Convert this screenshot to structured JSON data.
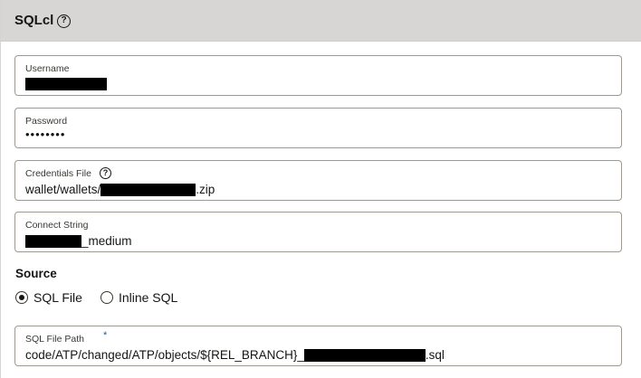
{
  "header": {
    "title": "SQLcl",
    "help_glyph": "?"
  },
  "fields": {
    "username": {
      "label": "Username",
      "value": ""
    },
    "password": {
      "label": "Password",
      "value": "••••••••"
    },
    "credentials_file": {
      "label": "Credentials File",
      "help_glyph": "?",
      "prefix": "wallet/wallets/",
      "suffix": ".zip"
    },
    "connect_string": {
      "label": "Connect String",
      "suffix": "_medium"
    },
    "sql_file_path": {
      "label": "SQL File Path",
      "required": "*",
      "prefix": "code/ATP/changed/ATP/objects/${REL_BRANCH}_",
      "suffix": ".sql"
    }
  },
  "source": {
    "title": "Source",
    "options": [
      {
        "label": "SQL File",
        "selected": true
      },
      {
        "label": "Inline SQL",
        "selected": false
      }
    ]
  }
}
